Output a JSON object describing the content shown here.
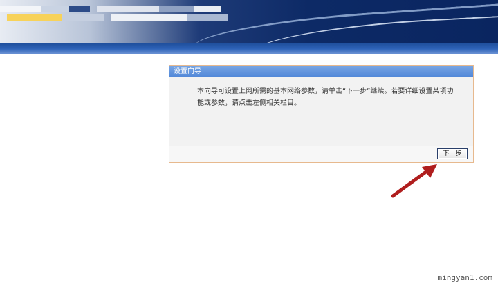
{
  "wizard": {
    "title": "设置向导",
    "description": "本向导可设置上网所需的基本网络参数，请单击“下一步”继续。若要详细设置某项功能或参数，请点击左侧相关栏目。",
    "next_button": "下一步"
  },
  "watermark": "mingyan1.com",
  "colors": {
    "title_bar": "#4f86d8",
    "panel_border": "#e7b98e",
    "arrow": "#b01e1e"
  }
}
